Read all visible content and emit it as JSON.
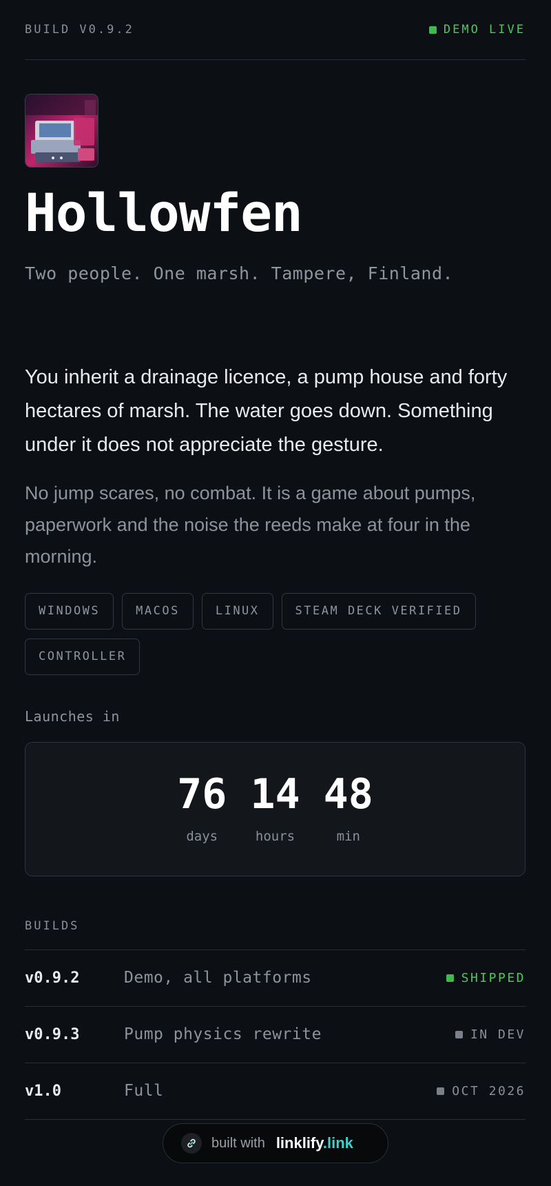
{
  "header": {
    "build": "BUILD V0.9.2",
    "status": "DEMO LIVE",
    "status_color": "#3fb950"
  },
  "game": {
    "cover_alt": "game cover art",
    "title": "Hollowfen",
    "tagline": "Two people. One marsh. Tampere, Finland.",
    "intro": "You inherit a drainage licence, a pump house and forty hectares of marsh. The water goes down. Something under it does not appreciate the gesture.",
    "intro2": "No jump scares, no combat. It is a game about pumps, paperwork and the noise the reeds make at four in the morning."
  },
  "tags": [
    "WINDOWS",
    "MACOS",
    "LINUX",
    "STEAM DECK VERIFIED",
    "CONTROLLER"
  ],
  "countdown": {
    "label": "Launches in",
    "days": "76",
    "days_label": "days",
    "hours": "14",
    "hours_label": "hours",
    "min": "48",
    "min_label": "min"
  },
  "builds": {
    "label": "BUILDS",
    "rows": [
      {
        "version": "v0.9.2",
        "desc": "Demo, all platforms",
        "status": "SHIPPED",
        "color": "#3fb950"
      },
      {
        "version": "v0.9.3",
        "desc": "Pump physics rewrite",
        "status": "IN DEV",
        "color": "#8a9099"
      },
      {
        "version": "v1.0",
        "desc": "Full",
        "status": "OCT 2026",
        "color": "#8a9099"
      }
    ]
  },
  "badge": {
    "prefix": "built with",
    "brand": "linklify",
    "brand_tld": ".link",
    "icon": "link-icon"
  }
}
